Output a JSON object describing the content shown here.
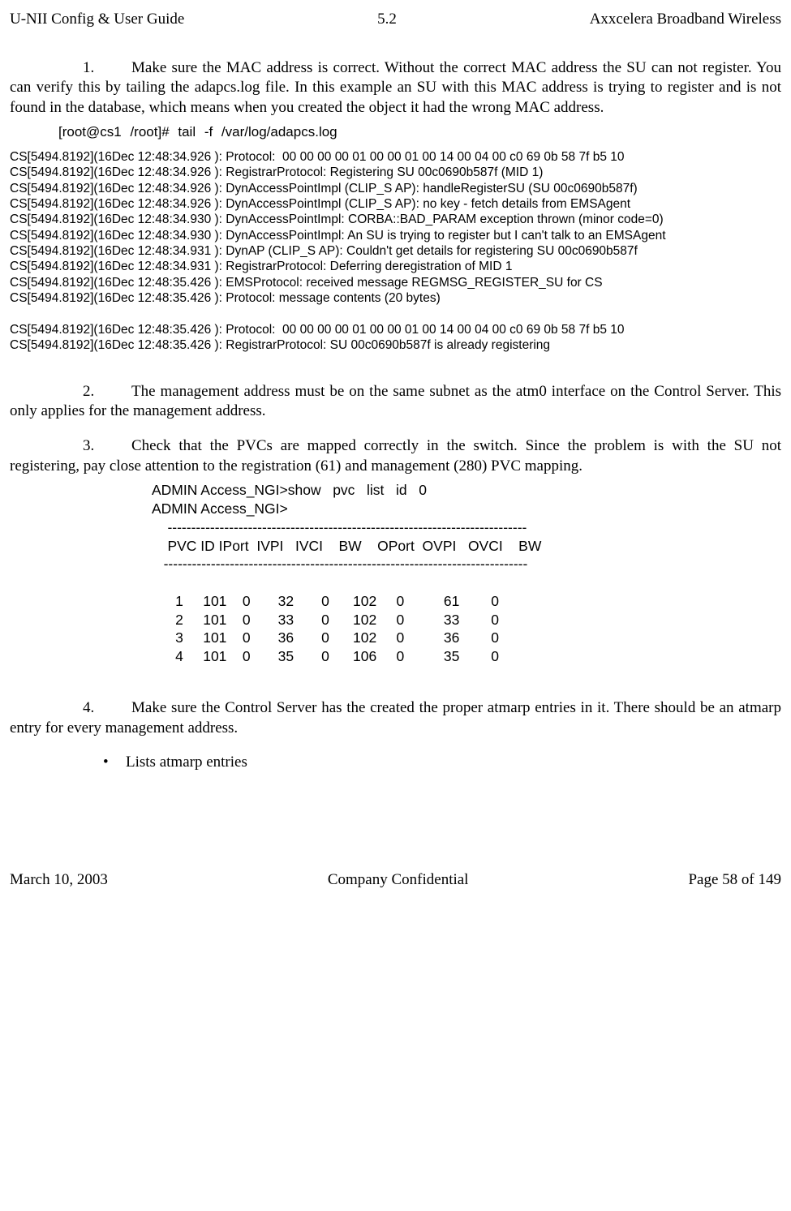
{
  "header": {
    "left": "U-NII Config & User Guide",
    "center": "5.2",
    "right": "Axxcelera Broadband Wireless"
  },
  "steps": {
    "s1": {
      "num": "1.",
      "text": "Make sure the MAC address is correct.  Without the correct MAC address the SU can not register. You can verify this by tailing the adapcs.log file. In this example an SU with this MAC address is trying to register and is not found in the database, which means when you created the object it had the wrong MAC address."
    },
    "cmd1": "[root@cs1 /root]#   tail   -f   /var/log/adapcs.log",
    "log": "CS[5494.8192](16Dec 12:48:34.926 ): Protocol:  00 00 00 00 01 00 00 01 00 14 00 04 00 c0 69 0b 58 7f b5 10\nCS[5494.8192](16Dec 12:48:34.926 ): RegistrarProtocol: Registering SU 00c0690b587f (MID 1)\nCS[5494.8192](16Dec 12:48:34.926 ): DynAccessPointImpl (CLIP_S AP): handleRegisterSU (SU 00c0690b587f)\nCS[5494.8192](16Dec 12:48:34.926 ): DynAccessPointImpl (CLIP_S AP): no key - fetch details from EMSAgent\nCS[5494.8192](16Dec 12:48:34.930 ): DynAccessPointImpl: CORBA::BAD_PARAM exception thrown (minor code=0)\nCS[5494.8192](16Dec 12:48:34.930 ): DynAccessPointImpl: An SU is trying to register but I can't talk to an EMSAgent\nCS[5494.8192](16Dec 12:48:34.931 ): DynAP (CLIP_S AP): Couldn't get details for registering SU 00c0690b587f\nCS[5494.8192](16Dec 12:48:34.931 ): RegistrarProtocol: Deferring deregistration of MID 1\nCS[5494.8192](16Dec 12:48:35.426 ): EMSProtocol: received message REGMSG_REGISTER_SU for CS\nCS[5494.8192](16Dec 12:48:35.426 ): Protocol: message contents (20 bytes)\n\nCS[5494.8192](16Dec 12:48:35.426 ): Protocol:  00 00 00 00 01 00 00 01 00 14 00 04 00 c0 69 0b 58 7f b5 10\nCS[5494.8192](16Dec 12:48:35.426 ): RegistrarProtocol: SU 00c0690b587f is already registering",
    "s2": {
      "num": "2.",
      "text": "The management address must be on the same subnet as the atm0 interface on the Control Server. This only applies for the management address."
    },
    "s3": {
      "num": "3.",
      "text": "Check that the PVCs are mapped correctly in the switch.  Since the problem is with the SU not registering, pay close attention to the registration (61) and management (280) PVC mapping."
    },
    "pvc": "ADMIN Access_NGI>show   pvc   list   id   0\nADMIN Access_NGI>\n    ----------------------------------------------------------------------------\n    PVC ID IPort  IVPI   IVCI    BW    OPort  OVPI   OVCI    BW\n   -----------------------------------------------------------------------------\n\n      1     101    0       32       0      102     0          61        0\n      2     101    0       33       0      102     0          33        0\n      3     101    0       36       0      102     0          36        0\n      4     101    0       35       0      106     0          35        0",
    "s4": {
      "num": "4.",
      "text": "Make sure the Control Server has the created the proper atmarp entries in it. There should be an atmarp entry for every management address."
    },
    "bullet1": "Lists atmarp entries"
  },
  "footer": {
    "left": "March 10, 2003",
    "center": "Company Confidential",
    "right": "Page 58 of 149"
  },
  "chart_data": {
    "type": "table",
    "title": "PVC list id 0",
    "columns": [
      "PVC ID",
      "IPort",
      "IVPI",
      "IVCI",
      "BW",
      "OPort",
      "OVPI",
      "OVCI",
      "BW"
    ],
    "rows": [
      [
        1,
        101,
        0,
        32,
        0,
        102,
        0,
        61,
        0
      ],
      [
        2,
        101,
        0,
        33,
        0,
        102,
        0,
        33,
        0
      ],
      [
        3,
        101,
        0,
        36,
        0,
        102,
        0,
        36,
        0
      ],
      [
        4,
        101,
        0,
        35,
        0,
        106,
        0,
        35,
        0
      ]
    ]
  }
}
